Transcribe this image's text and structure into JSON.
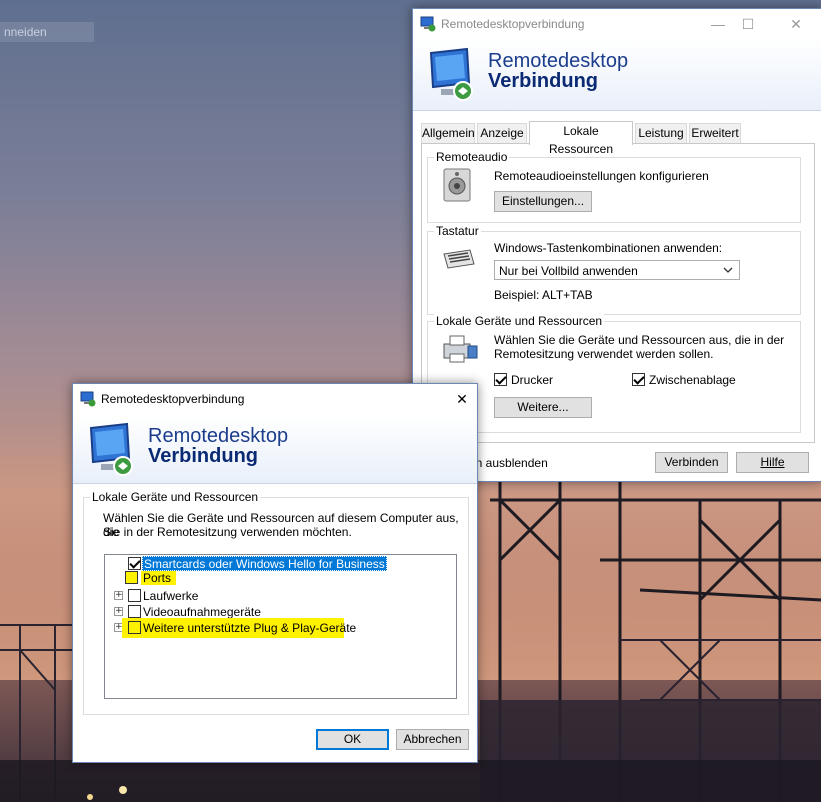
{
  "desktop": {
    "search_label": "nneiden"
  },
  "main_window": {
    "title": "Remotedesktopverbindung",
    "banner_line1": "Remotedesktop",
    "banner_line2": "Verbindung",
    "tabs": [
      "Allgemein",
      "Anzeige",
      "Lokale Ressourcen",
      "Leistung",
      "Erweitert"
    ],
    "active_tab": "Lokale Ressourcen",
    "remoteaudio": {
      "label": "Remoteaudio",
      "description": "Remoteaudioeinstellungen konfigurieren",
      "button": "Einstellungen..."
    },
    "tastatur": {
      "label": "Tastatur",
      "description": "Windows-Tastenkombinationen anwenden:",
      "select_value": "Nur bei Vollbild anwenden",
      "example": "Beispiel: ALT+TAB"
    },
    "lokale_geraete": {
      "label": "Lokale Geräte und Ressourcen",
      "description_line1": "Wählen Sie die Geräte und Ressourcen aus, die in der",
      "description_line2": "Remotesitzung verwendet werden sollen.",
      "drucker": "Drucker",
      "drucker_checked": true,
      "zwischenablage": "Zwischenablage",
      "zwischenablage_checked": true,
      "button": "Weitere..."
    },
    "options_partial": "en ausblenden",
    "connect_button": "Verbinden",
    "help_button": "Hilfe"
  },
  "dialog": {
    "title": "Remotedesktopverbindung",
    "banner_line1": "Remotedesktop",
    "banner_line2": "Verbindung",
    "group_label": "Lokale Geräte und Ressourcen",
    "description_line1": "Wählen Sie die Geräte und Ressourcen auf diesem Computer aus, die",
    "description_line2": "Sie in der Remotesitzung verwenden möchten.",
    "items": [
      {
        "label": "Smartcards oder Windows Hello for Business",
        "checked": true,
        "expandable": false,
        "selected": true,
        "highlighted": false
      },
      {
        "label": "Ports",
        "checked": false,
        "expandable": false,
        "selected": false,
        "highlighted": true
      },
      {
        "label": "Laufwerke",
        "checked": false,
        "expandable": true,
        "selected": false,
        "highlighted": false
      },
      {
        "label": "Videoaufnahmegeräte",
        "checked": false,
        "expandable": true,
        "selected": false,
        "highlighted": false
      },
      {
        "label": "Weitere unterstützte Plug & Play-Geräte",
        "checked": false,
        "expandable": true,
        "selected": false,
        "highlighted": true
      }
    ],
    "ok_button": "OK",
    "cancel_button": "Abbrechen"
  },
  "colors": {
    "title_blue": "#1c3d8c",
    "selection_blue": "#0078d7",
    "highlight_yellow": "#fff200"
  }
}
